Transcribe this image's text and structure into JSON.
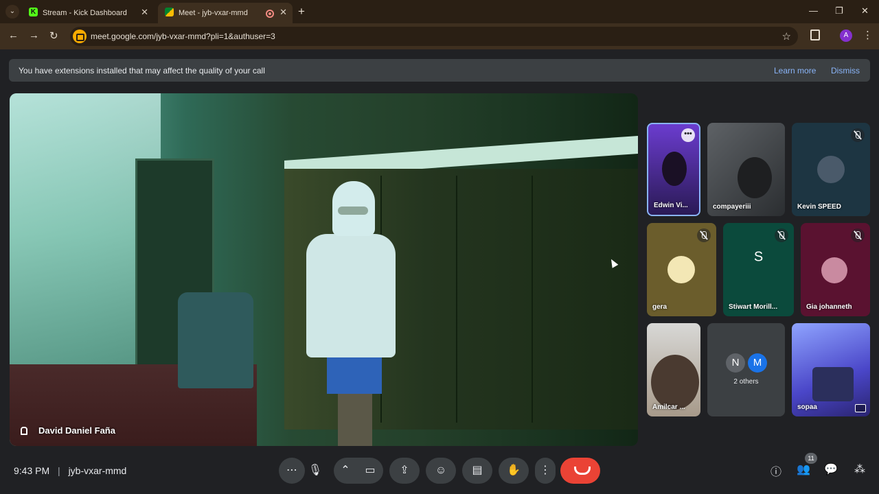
{
  "browser": {
    "tabs": [
      {
        "title": "Stream - Kick Dashboard",
        "favicon": "kick-icon",
        "favicon_letter": "K"
      },
      {
        "title": "Meet - jyb-vxar-mmd",
        "favicon": "meet-icon",
        "recording": true
      }
    ],
    "url": "meet.google.com/jyb-vxar-mmd?pli=1&authuser=3",
    "profile_initial": "A",
    "new_tab_glyph": "+",
    "window_controls": {
      "minimize": "—",
      "maximize": "❐",
      "close": "✕"
    }
  },
  "banner": {
    "text": "You have extensions installed that may affect the quality of your call",
    "learn_more": "Learn more",
    "dismiss": "Dismiss"
  },
  "main_video": {
    "participant": "David Daniel Faña",
    "pinned": true
  },
  "participants": [
    {
      "name": "Edwin Vi...",
      "speaking": true
    },
    {
      "name": "compayeriii"
    },
    {
      "name": "Kevin SPEED",
      "muted": true
    },
    {
      "name": "gera",
      "muted": true
    },
    {
      "name": "Stiwart Morill...",
      "muted": true,
      "initial": "S"
    },
    {
      "name": "Gia johanneth",
      "muted": true
    },
    {
      "name": "Amilcar ..."
    },
    {
      "others_label": "2 others",
      "initials": [
        "N",
        "M"
      ]
    },
    {
      "name": "sopaa"
    }
  ],
  "meeting": {
    "time": "9:43 PM",
    "separator": "|",
    "code": "jyb-vxar-mmd",
    "people_count": "11"
  },
  "controls": {
    "more_options": "⋯",
    "mic": "🎙",
    "chevron": "⌃",
    "camera": "▭",
    "present": "⇪",
    "emoji": "☺",
    "captions": "▤",
    "raise_hand": "✋",
    "kebab": "⋮"
  },
  "colors": {
    "accent": "#8ab4f8",
    "end_call": "#ea4335",
    "control_bg": "#3c4043",
    "speaking_border": "#8ab4f8"
  }
}
